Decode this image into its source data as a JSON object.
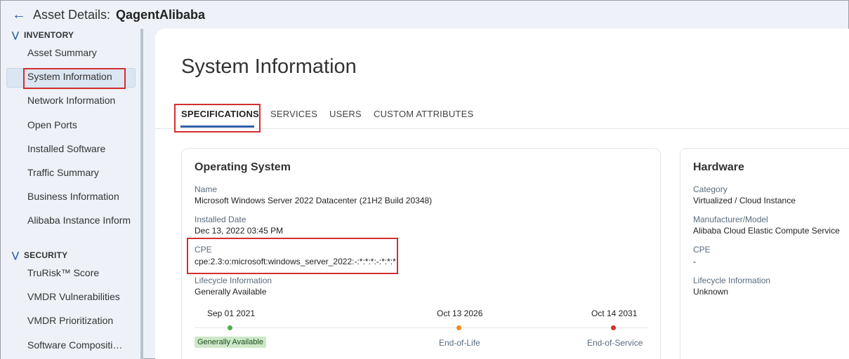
{
  "header": {
    "back_icon": "arrow-left-icon",
    "title_prefix": "Asset Details:",
    "asset_name": "QagentAlibaba"
  },
  "sidebar": {
    "inventory_heading": "INVENTORY",
    "security_heading": "SECURITY",
    "inventory_items": [
      {
        "label": "Asset Summary"
      },
      {
        "label": "System Information"
      },
      {
        "label": "Network Information"
      },
      {
        "label": "Open Ports"
      },
      {
        "label": "Installed Software"
      },
      {
        "label": "Traffic Summary"
      },
      {
        "label": "Business Information"
      },
      {
        "label": "Alibaba Instance Inform"
      }
    ],
    "security_items": [
      {
        "label": "TruRisk™ Score"
      },
      {
        "label": "VMDR Vulnerabilities"
      },
      {
        "label": "VMDR Prioritization"
      },
      {
        "label": "Software Compositi…"
      }
    ],
    "active_item": "System Information"
  },
  "main": {
    "page_title": "System Information",
    "tabs": [
      {
        "label": "SPECIFICATIONS"
      },
      {
        "label": "SERVICES"
      },
      {
        "label": "USERS"
      },
      {
        "label": "CUSTOM ATTRIBUTES"
      }
    ],
    "active_tab": "SPECIFICATIONS"
  },
  "os_card": {
    "title": "Operating System",
    "name_label": "Name",
    "name_value": "Microsoft Windows Server 2022 Datacenter (21H2 Build 20348)",
    "installed_label": "Installed Date",
    "installed_value": "Dec 13, 2022 03:45 PM",
    "cpe_label": "CPE",
    "cpe_value": "cpe:2.3:o:microsoft:windows_server_2022:-:*:*:*:-:*:*:*",
    "lifecycle_label": "Lifecycle Information",
    "lifecycle_value": "Generally Available",
    "timeline": [
      {
        "date": "Sep 01 2021",
        "label": "Generally Available",
        "color": "#4caf50"
      },
      {
        "date": "Oct 13 2026",
        "label": "End-of-Life",
        "color": "#f08a24"
      },
      {
        "date": "Oct 14 2031",
        "label": "End-of-Service",
        "color": "#d32f2f"
      }
    ]
  },
  "hw_card": {
    "title": "Hardware",
    "category_label": "Category",
    "category_value": "Virtualized / Cloud Instance",
    "manufacturer_label": "Manufacturer/Model",
    "manufacturer_value": "Alibaba Cloud Elastic Compute Service",
    "cpe_label": "CPE",
    "cpe_value": "-",
    "lifecycle_label": "Lifecycle Information",
    "lifecycle_value": "Unknown"
  },
  "colors": {
    "accent": "#2f5fa8",
    "highlight_border": "#d32f2f",
    "background": "#eef2f8"
  }
}
